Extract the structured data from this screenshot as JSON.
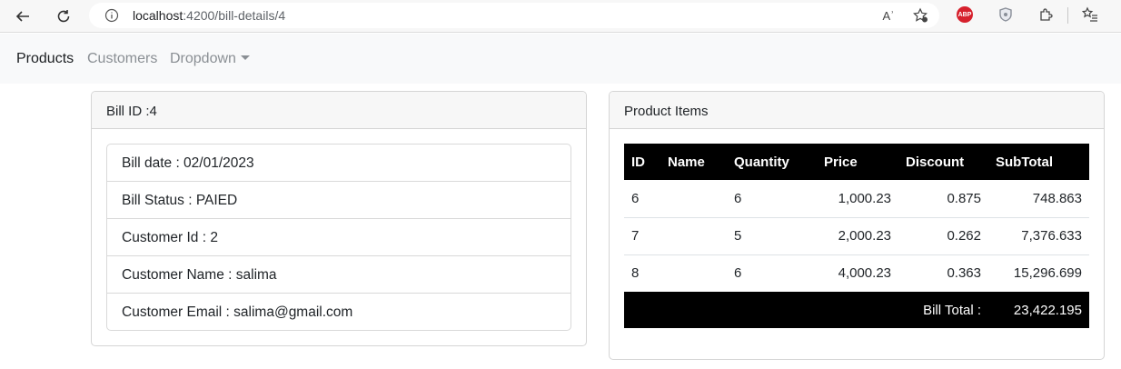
{
  "browser": {
    "url_host": "localhost",
    "url_path": ":4200/bill-details/4",
    "read_aloud_label": "Aʾ",
    "abp_label": "ABP"
  },
  "navbar": {
    "products": "Products",
    "customers": "Customers",
    "dropdown": "Dropdown"
  },
  "bill": {
    "header": "Bill ID :4",
    "items": [
      "Bill date : 02/01/2023",
      "Bill Status : PAIED",
      "Customer Id : 2",
      "Customer Name : salima",
      "Customer Email : salima@gmail.com"
    ]
  },
  "products": {
    "header": "Product Items",
    "columns": [
      "ID",
      "Name",
      "Quantity",
      "Price",
      "Discount",
      "SubTotal"
    ],
    "rows": [
      {
        "id": "6",
        "name": "",
        "quantity": "6",
        "price": "1,000.23",
        "discount": "0.875",
        "subtotal": "748.863"
      },
      {
        "id": "7",
        "name": "",
        "quantity": "5",
        "price": "2,000.23",
        "discount": "0.262",
        "subtotal": "7,376.633"
      },
      {
        "id": "8",
        "name": "",
        "quantity": "6",
        "price": "4,000.23",
        "discount": "0.363",
        "subtotal": "15,296.699"
      }
    ],
    "total_label": "Bill Total :",
    "total_value": "23,422.195"
  }
}
